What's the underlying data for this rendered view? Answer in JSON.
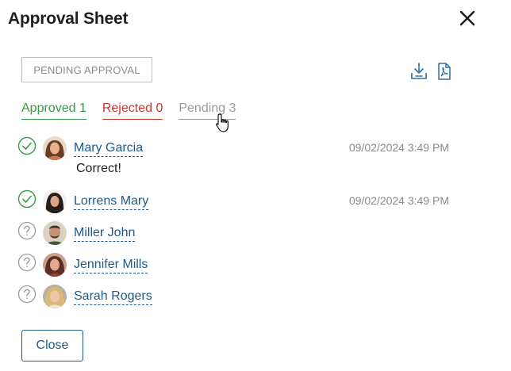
{
  "dialog": {
    "title": "Approval Sheet"
  },
  "status_badge": "PENDING APPROVAL",
  "tabs": [
    {
      "label": "Approved 1",
      "color": "#3a9a48"
    },
    {
      "label": "Rejected 0",
      "color": "#d2332b"
    },
    {
      "label": "Pending 3",
      "color": "#9a9a9a"
    }
  ],
  "approvers": [
    {
      "name": "Mary Garcia",
      "status": "approved",
      "time": "09/02/2024 3:49 PM",
      "comment": "Correct!"
    },
    {
      "name": "Lorrens Mary",
      "status": "approved",
      "time": "09/02/2024 3:49 PM"
    },
    {
      "name": "Miller John",
      "status": "pending"
    },
    {
      "name": "Jennifer Mills",
      "status": "pending"
    },
    {
      "name": "Sarah Rogers",
      "status": "pending"
    }
  ],
  "icons": {
    "close": "close-icon",
    "download": "download-icon",
    "pdf": "pdf-icon",
    "approved": "check-circle-icon",
    "pending": "question-circle-icon"
  },
  "buttons": {
    "close_label": "Close"
  },
  "colors": {
    "link": "#1d5a8c",
    "approved": "#3a9a48",
    "rejected": "#d2332b",
    "pending": "#9a9a9a"
  }
}
